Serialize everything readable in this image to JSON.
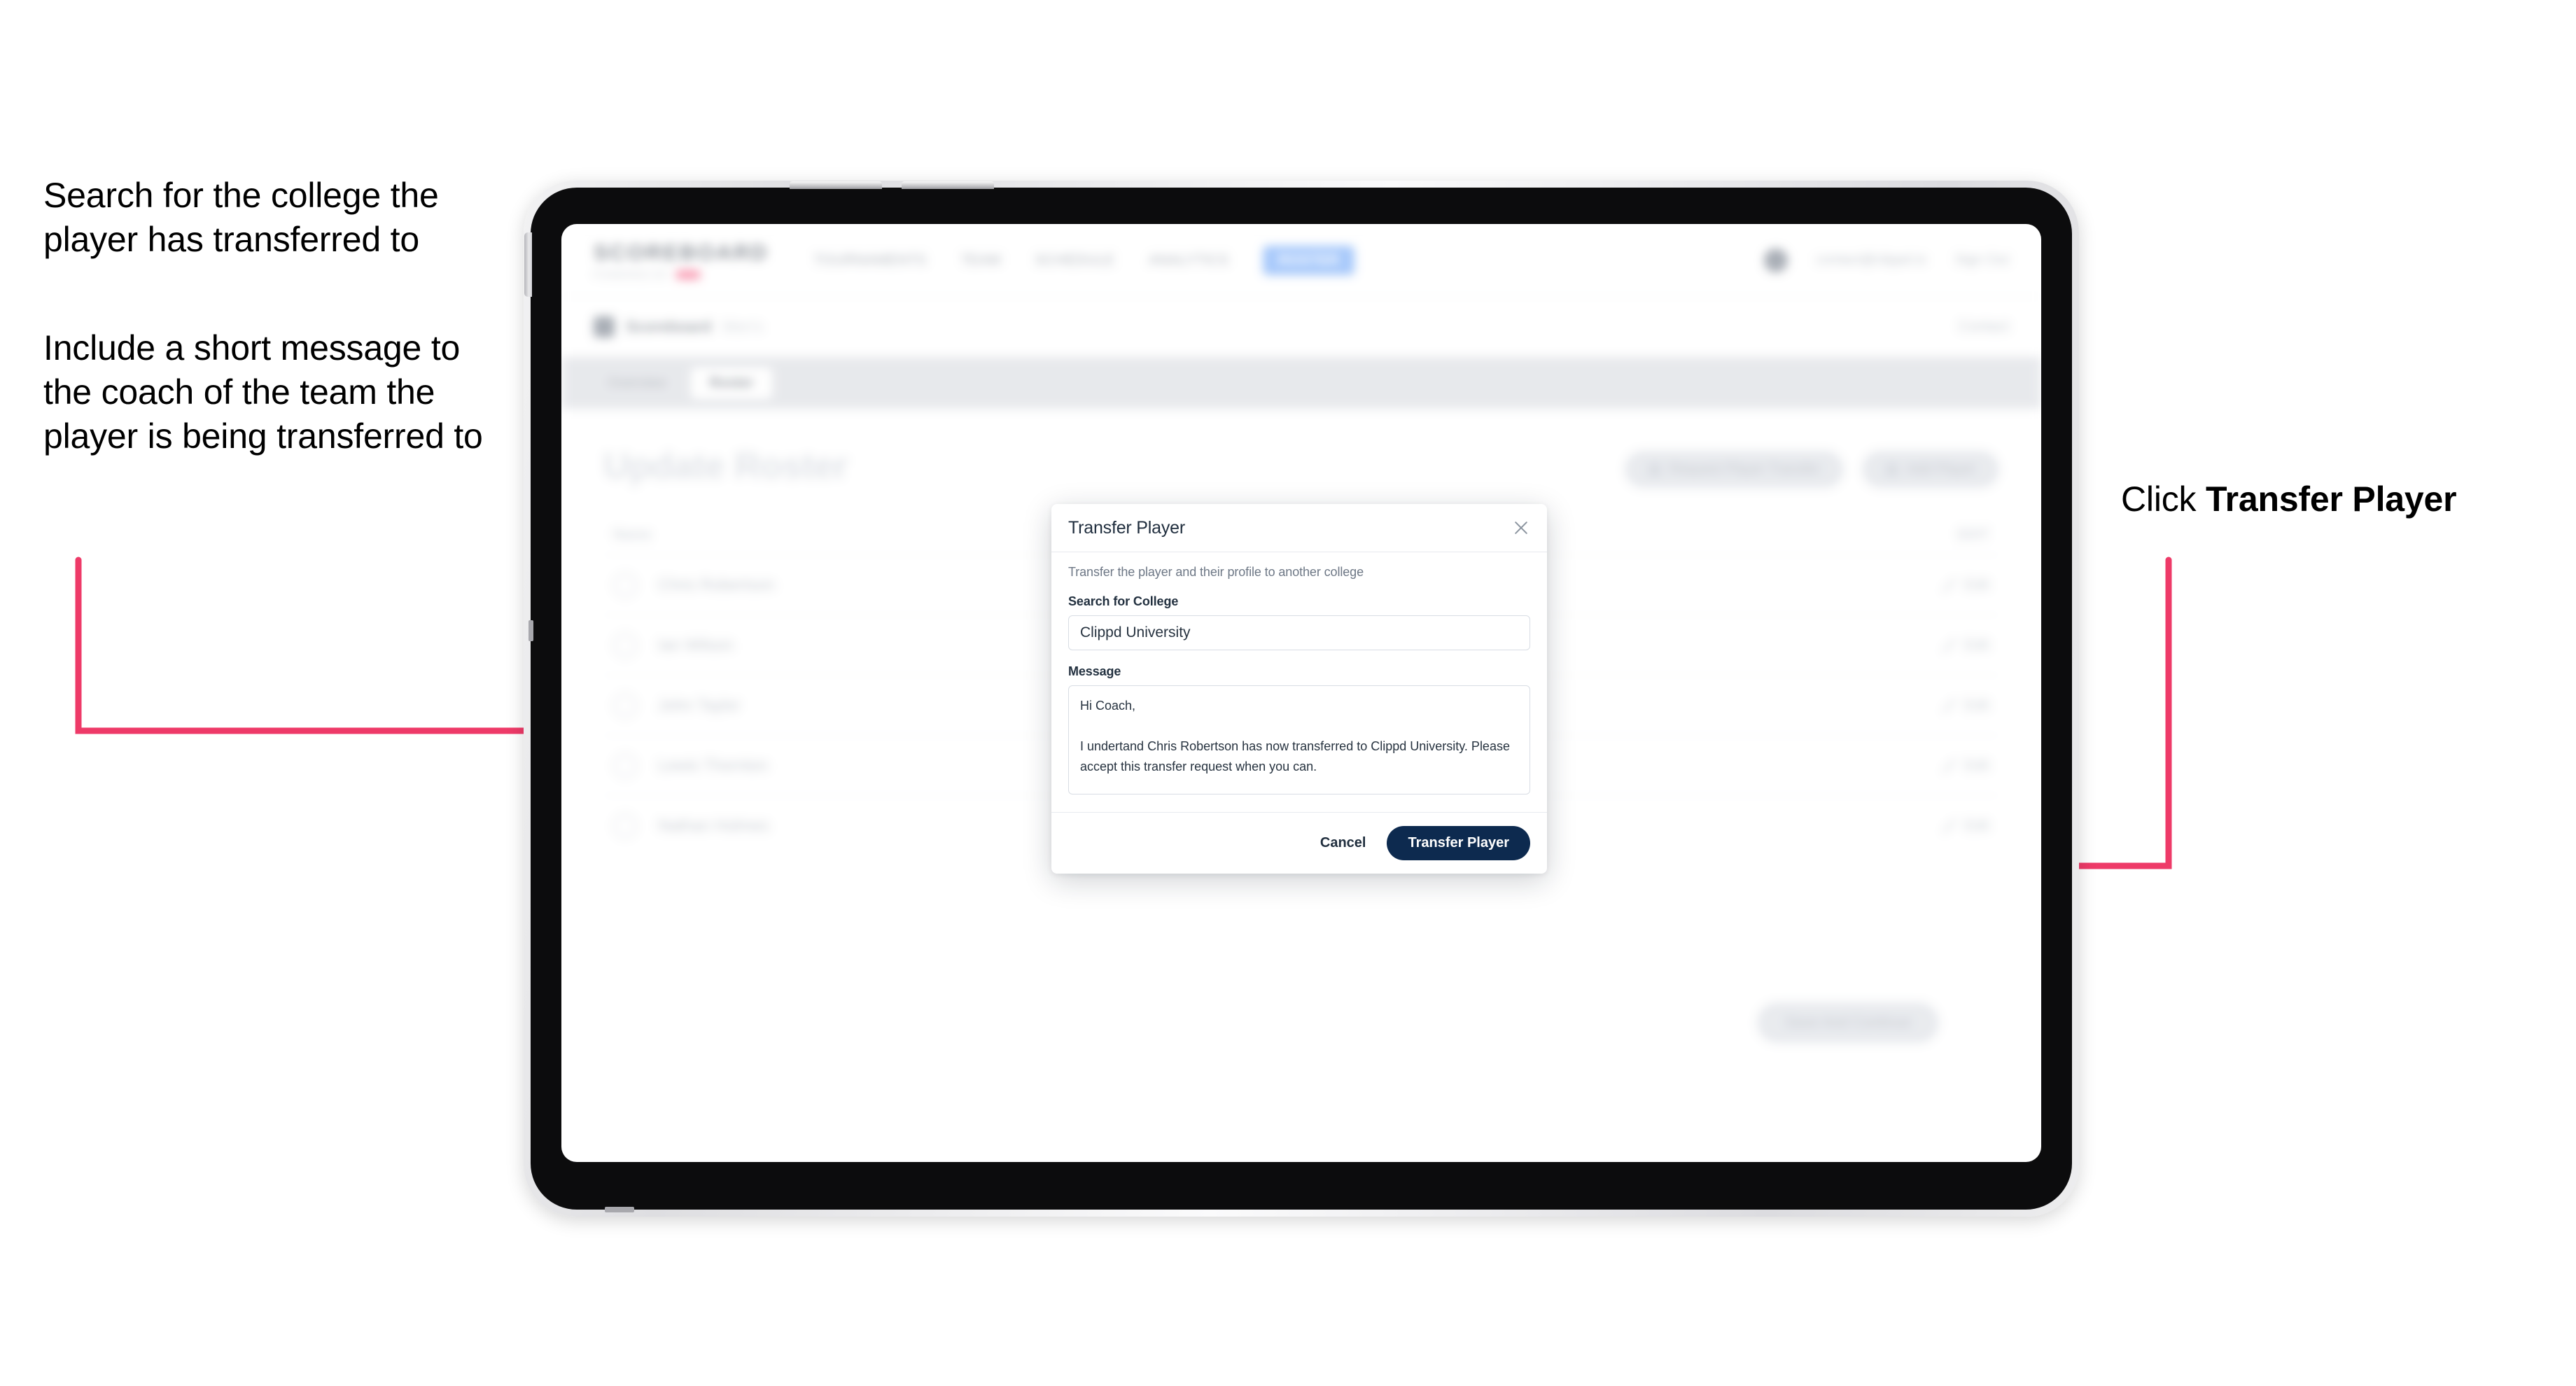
{
  "annotations": {
    "left_note_1": "Search for the college the player has transferred to",
    "left_note_2": "Include a short message to the coach of the team the player is being transferred to",
    "right_note_prefix": "Click ",
    "right_note_bold": "Transfer Player",
    "arrow_color": "#ee3a68"
  },
  "app": {
    "nav": {
      "brand_word": "SCOREBOARD",
      "brand_sub": "POWERED BY",
      "brand_badge": "clippd",
      "links": [
        {
          "label": "TOURNAMENTS"
        },
        {
          "label": "TEAM"
        },
        {
          "label": "SCHEDULE"
        },
        {
          "label": "ANALYTICS"
        },
        {
          "label": "ROSTER",
          "active": true
        }
      ],
      "email": "contact@clippd.io",
      "sign_out": "Sign Out"
    },
    "subnav": {
      "team_name": "Scoreboard",
      "team_sub": "Men's",
      "right_action": "Contact"
    },
    "tabs": [
      {
        "label": "Overview",
        "active": false
      },
      {
        "label": "Roster",
        "active": true
      }
    ],
    "page_title": "Update Roster",
    "head_actions": [
      {
        "label": "Request Player Transfer",
        "icon": "transfer-icon"
      },
      {
        "label": "Add Player",
        "icon": "plus-icon"
      }
    ],
    "roster": {
      "col_name": "Name",
      "col_action": "EDIT",
      "rows": [
        {
          "name": "Chris Robertson",
          "action": "Edit"
        },
        {
          "name": "Ian Wilson",
          "action": "Edit"
        },
        {
          "name": "John Taylor",
          "action": "Edit"
        },
        {
          "name": "Lewis Thornton",
          "action": "Edit"
        },
        {
          "name": "Nathan Holmes",
          "action": "Edit"
        }
      ]
    },
    "footer_action": "Save And Continue"
  },
  "modal": {
    "title": "Transfer Player",
    "description": "Transfer the player and their profile to another college",
    "college_label": "Search for College",
    "college_value": "Clippd University",
    "college_placeholder": "Search for College",
    "message_label": "Message",
    "message_value": "Hi Coach,\n\nI undertand Chris Robertson has now transferred to Clippd University. Please accept this transfer request when you can.",
    "message_placeholder": "Message",
    "cancel_label": "Cancel",
    "submit_label": "Transfer Player",
    "close_icon": "close-icon",
    "primary_color": "#0d2a4f"
  }
}
